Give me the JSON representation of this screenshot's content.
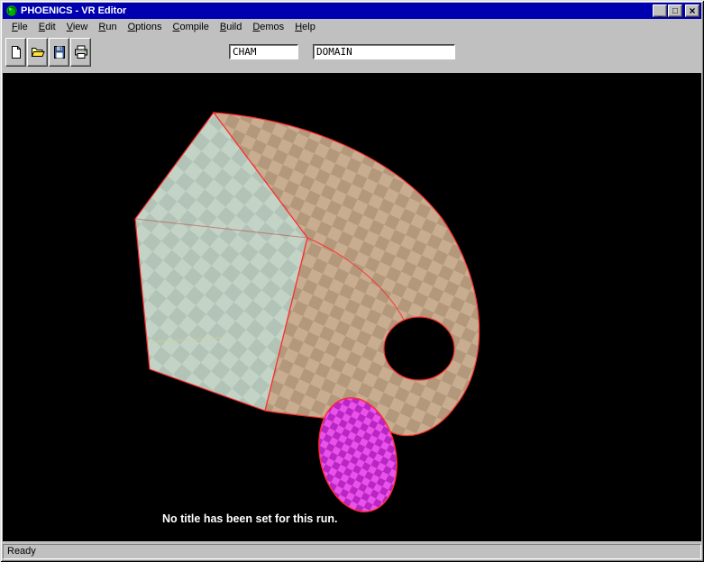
{
  "window": {
    "title": "PHOENICS - VR Editor",
    "controls": {
      "minimize": "_",
      "maximize": "□",
      "close": "×"
    }
  },
  "chrome": {
    "titlebar_color": "#0000b0",
    "chrome_gray": "#c0c0c0"
  },
  "menu": {
    "items": [
      {
        "label": "File"
      },
      {
        "label": "Edit"
      },
      {
        "label": "View"
      },
      {
        "label": "Run"
      },
      {
        "label": "Options"
      },
      {
        "label": "Compile"
      },
      {
        "label": "Build"
      },
      {
        "label": "Demos"
      },
      {
        "label": "Help"
      }
    ]
  },
  "toolbar": {
    "buttons": [
      {
        "name": "new-file"
      },
      {
        "name": "open-file"
      },
      {
        "name": "save-file"
      },
      {
        "name": "print"
      }
    ],
    "fields": [
      {
        "name": "case",
        "value": "CHAM"
      },
      {
        "name": "domain",
        "value": "DOMAIN"
      }
    ]
  },
  "viewport": {
    "message": "No title has been set for this run.",
    "background": "#000000"
  },
  "scene": {
    "description": "3D checkered horn object: pentagonal prism morphing into curled tube with circular end cap",
    "colors": {
      "wireframe": "#ff2a2a",
      "pentagon_light": "#c3d4c7",
      "pentagon_dark": "#b1c4b7",
      "horn_light": "#c8ad90",
      "horn_dark": "#b3987b",
      "cap_light": "#ea52ea",
      "cap_dark": "#b827c4",
      "hidden_edge": "#c04040",
      "seam_yellow": "#d2d28e"
    }
  },
  "statusbar": {
    "text": "Ready"
  }
}
